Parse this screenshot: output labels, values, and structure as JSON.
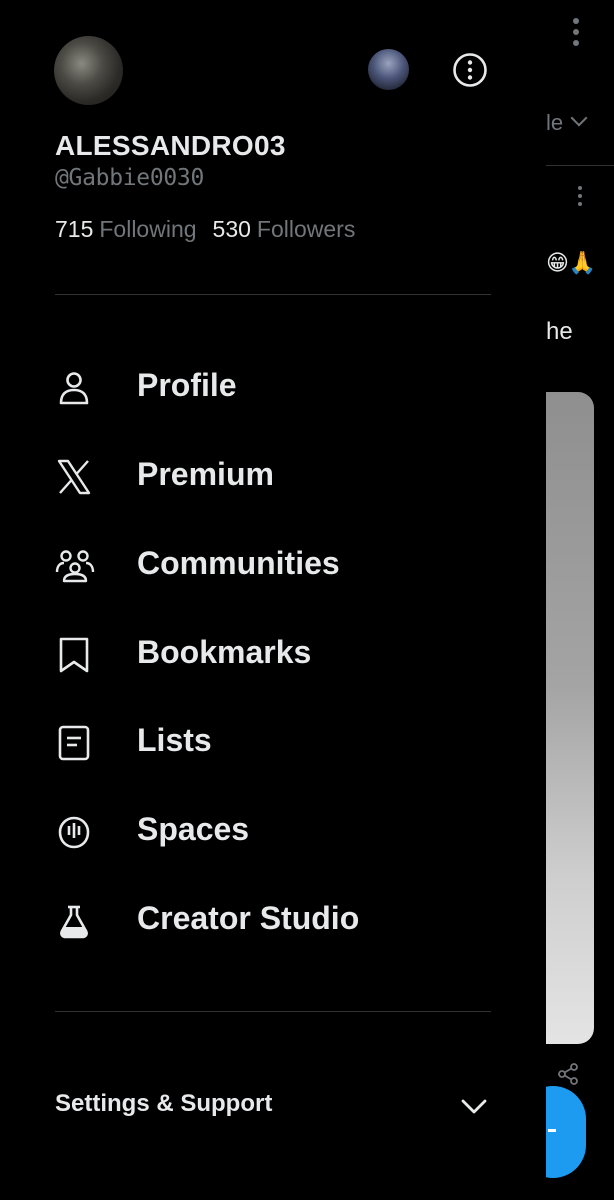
{
  "background": {
    "tab_partial": "le",
    "emoji_partial": "😁🙏",
    "text_partial": "he",
    "fab_color": "#1d9bf0"
  },
  "profile": {
    "display_name": "ALESSANDRO03",
    "handle": "@Gabbie0030",
    "following_count": "715",
    "following_label": "Following",
    "followers_count": "530",
    "followers_label": "Followers"
  },
  "nav": {
    "items": [
      {
        "label": "Profile",
        "icon": "person-icon"
      },
      {
        "label": "Premium",
        "icon": "x-logo-icon"
      },
      {
        "label": "Communities",
        "icon": "communities-icon"
      },
      {
        "label": "Bookmarks",
        "icon": "bookmark-icon"
      },
      {
        "label": "Lists",
        "icon": "list-icon"
      },
      {
        "label": "Spaces",
        "icon": "spaces-icon"
      },
      {
        "label": "Creator Studio",
        "icon": "flask-icon"
      }
    ]
  },
  "footer": {
    "settings_label": "Settings & Support"
  },
  "colors": {
    "background": "#000000",
    "text_primary": "#e7e9ea",
    "text_secondary": "#71767b",
    "divider": "#2f3336",
    "accent": "#1d9bf0"
  }
}
